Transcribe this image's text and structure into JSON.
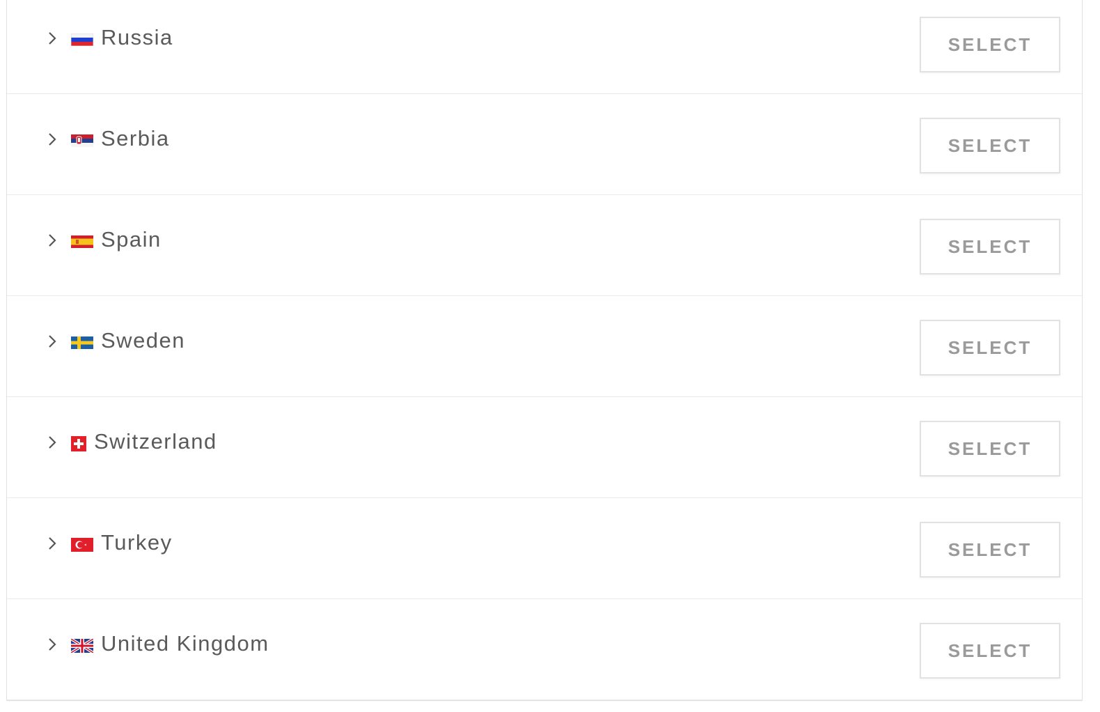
{
  "countries": [
    {
      "name": "Russia",
      "flag_icon": "russia-flag-icon",
      "button_label": "SELECT"
    },
    {
      "name": "Serbia",
      "flag_icon": "serbia-flag-icon",
      "button_label": "SELECT"
    },
    {
      "name": "Spain",
      "flag_icon": "spain-flag-icon",
      "button_label": "SELECT"
    },
    {
      "name": "Sweden",
      "flag_icon": "sweden-flag-icon",
      "button_label": "SELECT"
    },
    {
      "name": "Switzerland",
      "flag_icon": "switzerland-flag-icon",
      "button_label": "SELECT"
    },
    {
      "name": "Turkey",
      "flag_icon": "turkey-flag-icon",
      "button_label": "SELECT"
    },
    {
      "name": "United Kingdom",
      "flag_icon": "united-kingdom-flag-icon",
      "button_label": "SELECT"
    }
  ],
  "colors": {
    "text": "#5a5a5a",
    "button_text": "#9a9a9a",
    "border": "#e2e2e2",
    "chevron": "#555555"
  }
}
